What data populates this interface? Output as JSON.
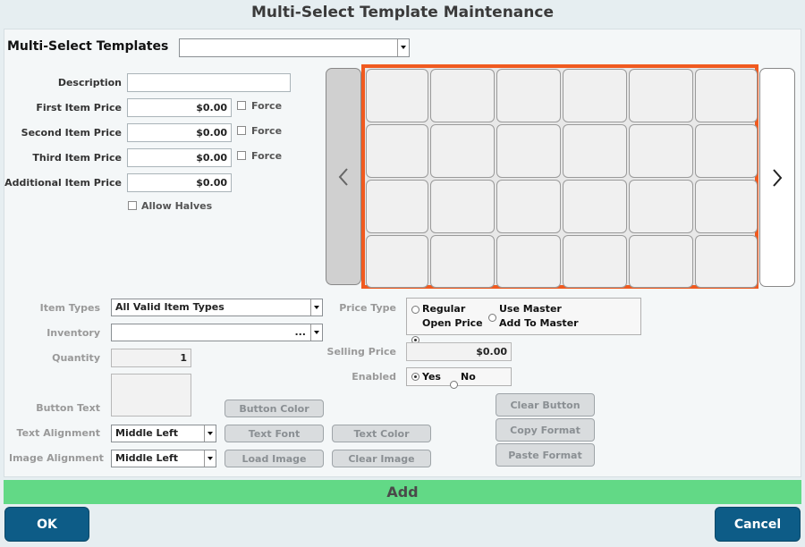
{
  "window": {
    "title": "Multi-Select Template Maintenance"
  },
  "templates": {
    "label": "Multi-Select Templates",
    "value": ""
  },
  "form": {
    "description": {
      "label": "Description",
      "value": ""
    },
    "first_price": {
      "label": "First Item Price",
      "value": "$0.00",
      "force_label": "Force"
    },
    "second_price": {
      "label": "Second Item Price",
      "value": "$0.00",
      "force_label": "Force"
    },
    "third_price": {
      "label": "Third Item Price",
      "value": "$0.00",
      "force_label": "Force"
    },
    "additional_price": {
      "label": "Additional Item Price",
      "value": "$0.00"
    },
    "allow_halves": {
      "label": "Allow Halves"
    }
  },
  "grid": {
    "rows": 4,
    "columns": 6
  },
  "nav": {
    "prev": "<",
    "next": ">"
  },
  "item_types": {
    "label": "Item Types",
    "value": "All Valid Item Types"
  },
  "inventory": {
    "label": "Inventory",
    "value": "",
    "ellipsis": "..."
  },
  "quantity": {
    "label": "Quantity",
    "value": "1"
  },
  "button_text": {
    "label": "Button Text",
    "value": ""
  },
  "text_alignment": {
    "label": "Text Alignment",
    "value": "Middle Left"
  },
  "image_alignment": {
    "label": "Image Alignment",
    "value": "Middle Left"
  },
  "buttons": {
    "button_color": "Button Color",
    "text_font": "Text Font",
    "text_color": "Text Color",
    "load_image": "Load Image",
    "clear_image": "Clear Image",
    "clear_button": "Clear Button",
    "copy_format": "Copy Format",
    "paste_format": "Paste Format"
  },
  "price_type": {
    "label": "Price Type",
    "options": [
      "Regular",
      "Use Master",
      "Open Price",
      "Add To Master"
    ],
    "selected": "Open Price"
  },
  "selling_price": {
    "label": "Selling Price",
    "value": "$0.00"
  },
  "enabled": {
    "label": "Enabled",
    "yes": "Yes",
    "no": "No",
    "selected": "Yes"
  },
  "footer": {
    "add": "Add",
    "ok": "OK",
    "cancel": "Cancel"
  },
  "colors": {
    "accent": "#0d5c87",
    "add_bar": "#62d986",
    "selection": "#f05a1f"
  }
}
